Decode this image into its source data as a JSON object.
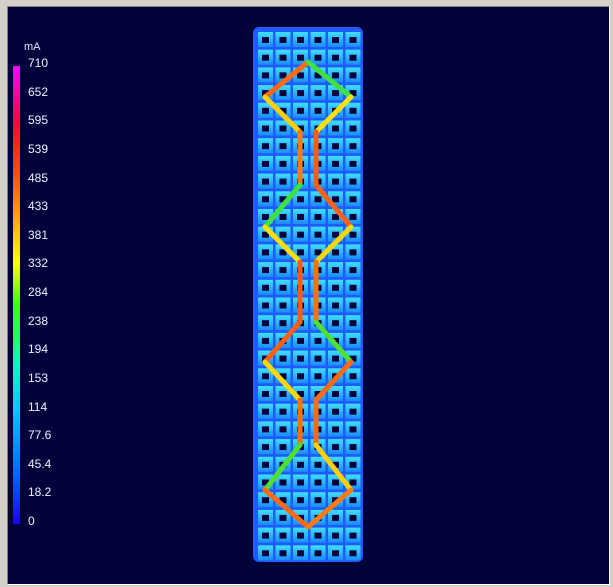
{
  "chart_data": {
    "type": "heatmap",
    "title": "",
    "colorbar": {
      "unit": "mA",
      "ticks": [
        "710",
        "652",
        "595",
        "539",
        "485",
        "433",
        "381",
        "332",
        "284",
        "238",
        "194",
        "153",
        "114",
        "77.6",
        "45.4",
        "18.2",
        "0"
      ],
      "range": [
        0,
        710
      ]
    },
    "structure": "mesh patch with meandering diamond-shaped current path",
    "colors": {
      "background": "#02023a",
      "mesh": "#1e6cff",
      "path_high": "#ff5000",
      "path_mid": "#ffe000"
    }
  }
}
